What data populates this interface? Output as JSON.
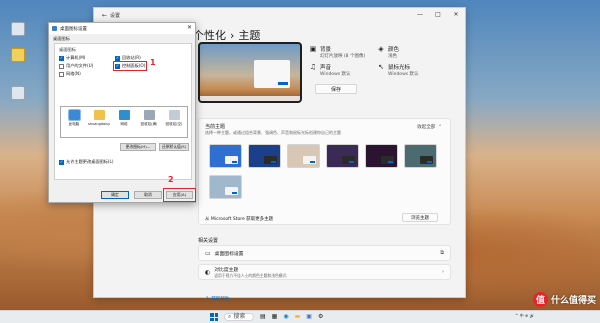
{
  "desktop": {
    "icons": [
      "recycle-bin",
      "store"
    ]
  },
  "settings": {
    "app_title": "设置",
    "window_controls": {
      "minimize": "—",
      "maximize": "□",
      "close": "✕"
    },
    "breadcrumb": {
      "parent": "个性化",
      "separator": "›",
      "current": "主题"
    },
    "props": [
      {
        "icon": "image-icon",
        "glyph": "▣",
        "name": "背景",
        "value": "幻灯片放映 (8 个图像)"
      },
      {
        "icon": "palette-icon",
        "glyph": "◈",
        "name": "颜色",
        "value": "浅色"
      },
      {
        "icon": "sound-icon",
        "glyph": "♫",
        "name": "声音",
        "value": "Windows 默认"
      },
      {
        "icon": "cursor-icon",
        "glyph": "↖",
        "name": "鼠标光标",
        "value": "Windows 默认"
      }
    ],
    "save_label": "保存",
    "theme_card": {
      "title": "当前主题",
      "subtitle": "选择一种主题，或通过组合背景、强调色、声音和鼠标光标创建你自己的主题",
      "collapse_label": "收起全部",
      "chevron": "⌃",
      "store_text": "从 Microsoft Store 获取更多主题",
      "browse_label": "浏览主题"
    },
    "theme_tiles": [
      {
        "bg": "#2f6fd1",
        "mini": "light"
      },
      {
        "bg": "#1b3f8a",
        "mini": "dark"
      },
      {
        "bg": "#d8c7b4",
        "mini": "light"
      },
      {
        "bg": "#3a2a55",
        "mini": "dark"
      },
      {
        "bg": "#2a1430",
        "mini": "dark"
      },
      {
        "bg": "#4b6b70",
        "mini": "dark"
      },
      {
        "bg": "#9fb8cc",
        "mini": "light"
      }
    ],
    "related_title": "相关设置",
    "related": [
      {
        "icon": "monitor-icon",
        "glyph": "▭",
        "label": "桌面图标设置",
        "sub": "",
        "end_glyph": "⧉"
      },
      {
        "icon": "contrast-icon",
        "glyph": "◐",
        "label": "对比度主题",
        "sub": "适用于视力不佳人士的颜色主题和浅色模式",
        "end_glyph": "›"
      }
    ],
    "help_label": "获取帮助"
  },
  "dialog": {
    "title": "桌面图标设置",
    "close_glyph": "✕",
    "tab_label": "桌面图标",
    "group_label": "桌面图标",
    "checkboxes": [
      {
        "label": "计算机(M)",
        "checked": true
      },
      {
        "label": "回收站(R)",
        "checked": true
      },
      {
        "label": "用户的文件(U)",
        "checked": false
      },
      {
        "label": "控制面板(O)",
        "checked": true
      },
      {
        "label": "网络(N)",
        "checked": false
      }
    ],
    "icons": [
      {
        "label": "此电脑",
        "color": "#3b88d6"
      },
      {
        "label": "shuangdaisy",
        "color": "#f0c24a"
      },
      {
        "label": "网络",
        "color": "#2e8fd0"
      },
      {
        "label": "回收站(满)",
        "color": "#9aa8b6"
      },
      {
        "label": "回收站(空)",
        "color": "#c3ccd5"
      }
    ],
    "change_icon_label": "更改图标(H)...",
    "restore_label": "还原默认值(S)",
    "allow_theme_label": "允许主题更改桌面图标(L)",
    "ok_label": "确定",
    "cancel_label": "取消",
    "apply_label": "应用(A)"
  },
  "annotations": {
    "step1": "1",
    "step2": "2"
  },
  "taskbar": {
    "search_label": "搜索",
    "tray_text": "^ 中 ⊕ 🔊"
  },
  "watermark": {
    "glyph": "值",
    "text": "什么值得买"
  },
  "colors": {
    "accent": "#0067c0",
    "annotation_red": "#e8222a"
  }
}
